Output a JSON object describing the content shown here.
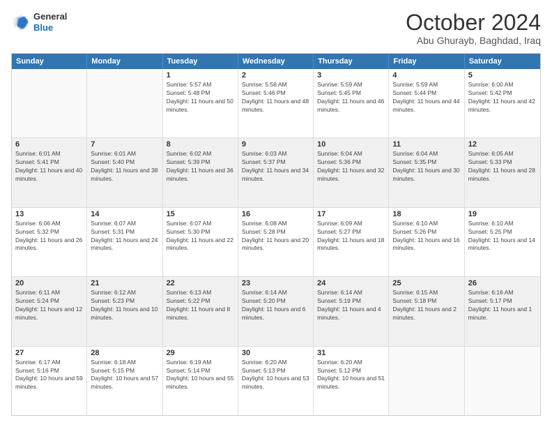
{
  "header": {
    "logo_general": "General",
    "logo_blue": "Blue",
    "month": "October 2024",
    "location": "Abu Ghurayb, Baghdad, Iraq"
  },
  "days_of_week": [
    "Sunday",
    "Monday",
    "Tuesday",
    "Wednesday",
    "Thursday",
    "Friday",
    "Saturday"
  ],
  "weeks": [
    [
      {
        "day": "",
        "sunrise": "",
        "sunset": "",
        "daylight": ""
      },
      {
        "day": "",
        "sunrise": "",
        "sunset": "",
        "daylight": ""
      },
      {
        "day": "1",
        "sunrise": "Sunrise: 5:57 AM",
        "sunset": "Sunset: 5:48 PM",
        "daylight": "Daylight: 11 hours and 50 minutes."
      },
      {
        "day": "2",
        "sunrise": "Sunrise: 5:58 AM",
        "sunset": "Sunset: 5:46 PM",
        "daylight": "Daylight: 11 hours and 48 minutes."
      },
      {
        "day": "3",
        "sunrise": "Sunrise: 5:59 AM",
        "sunset": "Sunset: 5:45 PM",
        "daylight": "Daylight: 11 hours and 46 minutes."
      },
      {
        "day": "4",
        "sunrise": "Sunrise: 5:59 AM",
        "sunset": "Sunset: 5:44 PM",
        "daylight": "Daylight: 11 hours and 44 minutes."
      },
      {
        "day": "5",
        "sunrise": "Sunrise: 6:00 AM",
        "sunset": "Sunset: 5:42 PM",
        "daylight": "Daylight: 11 hours and 42 minutes."
      }
    ],
    [
      {
        "day": "6",
        "sunrise": "Sunrise: 6:01 AM",
        "sunset": "Sunset: 5:41 PM",
        "daylight": "Daylight: 11 hours and 40 minutes."
      },
      {
        "day": "7",
        "sunrise": "Sunrise: 6:01 AM",
        "sunset": "Sunset: 5:40 PM",
        "daylight": "Daylight: 11 hours and 38 minutes."
      },
      {
        "day": "8",
        "sunrise": "Sunrise: 6:02 AM",
        "sunset": "Sunset: 5:39 PM",
        "daylight": "Daylight: 11 hours and 36 minutes."
      },
      {
        "day": "9",
        "sunrise": "Sunrise: 6:03 AM",
        "sunset": "Sunset: 5:37 PM",
        "daylight": "Daylight: 11 hours and 34 minutes."
      },
      {
        "day": "10",
        "sunrise": "Sunrise: 6:04 AM",
        "sunset": "Sunset: 5:36 PM",
        "daylight": "Daylight: 11 hours and 32 minutes."
      },
      {
        "day": "11",
        "sunrise": "Sunrise: 6:04 AM",
        "sunset": "Sunset: 5:35 PM",
        "daylight": "Daylight: 11 hours and 30 minutes."
      },
      {
        "day": "12",
        "sunrise": "Sunrise: 6:05 AM",
        "sunset": "Sunset: 5:33 PM",
        "daylight": "Daylight: 11 hours and 28 minutes."
      }
    ],
    [
      {
        "day": "13",
        "sunrise": "Sunrise: 6:06 AM",
        "sunset": "Sunset: 5:32 PM",
        "daylight": "Daylight: 11 hours and 26 minutes."
      },
      {
        "day": "14",
        "sunrise": "Sunrise: 6:07 AM",
        "sunset": "Sunset: 5:31 PM",
        "daylight": "Daylight: 11 hours and 24 minutes."
      },
      {
        "day": "15",
        "sunrise": "Sunrise: 6:07 AM",
        "sunset": "Sunset: 5:30 PM",
        "daylight": "Daylight: 11 hours and 22 minutes."
      },
      {
        "day": "16",
        "sunrise": "Sunrise: 6:08 AM",
        "sunset": "Sunset: 5:28 PM",
        "daylight": "Daylight: 11 hours and 20 minutes."
      },
      {
        "day": "17",
        "sunrise": "Sunrise: 6:09 AM",
        "sunset": "Sunset: 5:27 PM",
        "daylight": "Daylight: 11 hours and 18 minutes."
      },
      {
        "day": "18",
        "sunrise": "Sunrise: 6:10 AM",
        "sunset": "Sunset: 5:26 PM",
        "daylight": "Daylight: 11 hours and 16 minutes."
      },
      {
        "day": "19",
        "sunrise": "Sunrise: 6:10 AM",
        "sunset": "Sunset: 5:25 PM",
        "daylight": "Daylight: 11 hours and 14 minutes."
      }
    ],
    [
      {
        "day": "20",
        "sunrise": "Sunrise: 6:11 AM",
        "sunset": "Sunset: 5:24 PM",
        "daylight": "Daylight: 11 hours and 12 minutes."
      },
      {
        "day": "21",
        "sunrise": "Sunrise: 6:12 AM",
        "sunset": "Sunset: 5:23 PM",
        "daylight": "Daylight: 11 hours and 10 minutes."
      },
      {
        "day": "22",
        "sunrise": "Sunrise: 6:13 AM",
        "sunset": "Sunset: 5:22 PM",
        "daylight": "Daylight: 11 hours and 8 minutes."
      },
      {
        "day": "23",
        "sunrise": "Sunrise: 6:14 AM",
        "sunset": "Sunset: 5:20 PM",
        "daylight": "Daylight: 11 hours and 6 minutes."
      },
      {
        "day": "24",
        "sunrise": "Sunrise: 6:14 AM",
        "sunset": "Sunset: 5:19 PM",
        "daylight": "Daylight: 11 hours and 4 minutes."
      },
      {
        "day": "25",
        "sunrise": "Sunrise: 6:15 AM",
        "sunset": "Sunset: 5:18 PM",
        "daylight": "Daylight: 11 hours and 2 minutes."
      },
      {
        "day": "26",
        "sunrise": "Sunrise: 6:16 AM",
        "sunset": "Sunset: 5:17 PM",
        "daylight": "Daylight: 11 hours and 1 minute."
      }
    ],
    [
      {
        "day": "27",
        "sunrise": "Sunrise: 6:17 AM",
        "sunset": "Sunset: 5:16 PM",
        "daylight": "Daylight: 10 hours and 59 minutes."
      },
      {
        "day": "28",
        "sunrise": "Sunrise: 6:18 AM",
        "sunset": "Sunset: 5:15 PM",
        "daylight": "Daylight: 10 hours and 57 minutes."
      },
      {
        "day": "29",
        "sunrise": "Sunrise: 6:19 AM",
        "sunset": "Sunset: 5:14 PM",
        "daylight": "Daylight: 10 hours and 55 minutes."
      },
      {
        "day": "30",
        "sunrise": "Sunrise: 6:20 AM",
        "sunset": "Sunset: 5:13 PM",
        "daylight": "Daylight: 10 hours and 53 minutes."
      },
      {
        "day": "31",
        "sunrise": "Sunrise: 6:20 AM",
        "sunset": "Sunset: 5:12 PM",
        "daylight": "Daylight: 10 hours and 51 minutes."
      },
      {
        "day": "",
        "sunrise": "",
        "sunset": "",
        "daylight": ""
      },
      {
        "day": "",
        "sunrise": "",
        "sunset": "",
        "daylight": ""
      }
    ]
  ]
}
